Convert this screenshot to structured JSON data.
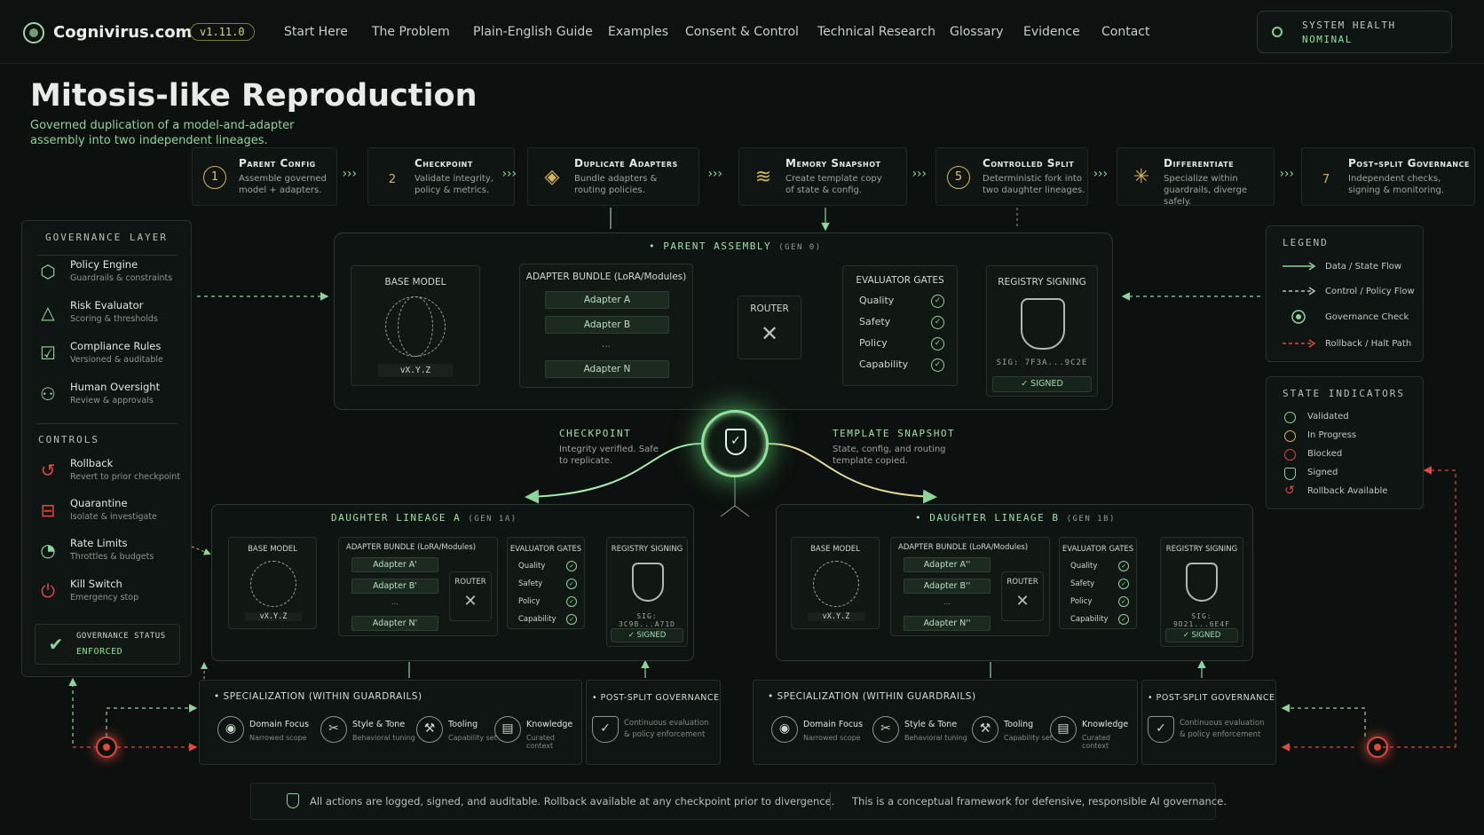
{
  "brand": {
    "name": "Cognivirus.com",
    "version": "v1.11.0"
  },
  "nav": [
    "Start Here",
    "The Problem",
    "Plain-English Guide",
    "Examples",
    "Consent & Control",
    "Technical Research",
    "Glossary",
    "Evidence",
    "Contact"
  ],
  "health": {
    "label": "SYSTEM HEALTH",
    "value": "NOMINAL"
  },
  "page": {
    "title": "Mitosis-like Reproduction",
    "subtitle": "Governed duplication of a model-and-adapter assembly into two independent lineages."
  },
  "steps": [
    {
      "num": "1",
      "title": "Parent Config",
      "desc": "Assemble governed model + adapters."
    },
    {
      "num": "2",
      "title": "Checkpoint",
      "desc": "Validate integrity, policy & metrics."
    },
    {
      "num": "",
      "title": "Duplicate Adapters",
      "desc": "Bundle adapters & routing policies."
    },
    {
      "num": "",
      "title": "Memory Snapshot",
      "desc": "Create template copy of state & config."
    },
    {
      "num": "5",
      "title": "Controlled Split",
      "desc": "Deterministic fork into two daughter lineages."
    },
    {
      "num": "",
      "title": "Differentiate",
      "desc": "Specialize within guardrails, diverge safely."
    },
    {
      "num": "7",
      "title": "Post-split Governance",
      "desc": "Independent checks, signing & monitoring."
    }
  ],
  "governance": {
    "title": "GOVERNANCE LAYER",
    "items": [
      {
        "name": "Policy Engine",
        "sub": "Guardrails & constraints"
      },
      {
        "name": "Risk Evaluator",
        "sub": "Scoring & thresholds"
      },
      {
        "name": "Compliance Rules",
        "sub": "Versioned & auditable"
      },
      {
        "name": "Human Oversight",
        "sub": "Review & approvals"
      }
    ],
    "controls_title": "CONTROLS",
    "controls": [
      {
        "name": "Rollback",
        "sub": "Revert to prior checkpoint"
      },
      {
        "name": "Quarantine",
        "sub": "Isolate & investigate"
      },
      {
        "name": "Rate Limits",
        "sub": "Throttles & budgets"
      },
      {
        "name": "Kill Switch",
        "sub": "Emergency stop"
      }
    ],
    "status_label": "GOVERNANCE STATUS",
    "status_value": "ENFORCED"
  },
  "parent": {
    "title": "• PARENT ASSEMBLY",
    "gen": "(GEN 0)",
    "base_model": "BASE MODEL",
    "version": "vX.Y.Z",
    "adapter_bundle": "ADAPTER BUNDLE (LoRA/Modules)",
    "adapters": [
      "Adapter A",
      "Adapter B",
      "...",
      "Adapter N"
    ],
    "router": "ROUTER",
    "gates_title": "EVALUATOR GATES",
    "gates": [
      "Quality",
      "Safety",
      "Policy",
      "Capability"
    ],
    "registry": "REGISTRY SIGNING",
    "sig": "SIG: 7F3A...9C2E",
    "signed": "SIGNED"
  },
  "callouts": {
    "checkpoint_title": "CHECKPOINT",
    "checkpoint_text": "Integrity verified. Safe to replicate.",
    "template_title": "TEMPLATE SNAPSHOT",
    "template_text": "State, config, and routing template copied."
  },
  "daughter_a": {
    "title": "DAUGHTER LINEAGE A",
    "gen": "(GEN 1A)",
    "base_model": "BASE MODEL",
    "version": "vX.Y.Z",
    "adapter_bundle": "ADAPTER BUNDLE (LoRA/Modules)",
    "adapters": [
      "Adapter A'",
      "Adapter B'",
      "...",
      "Adapter N'"
    ],
    "router": "ROUTER",
    "gates_title": "EVALUATOR GATES",
    "gates": [
      "Quality",
      "Safety",
      "Policy",
      "Capability"
    ],
    "registry": "REGISTRY SIGNING",
    "sig": "SIG: 3C9B...A71D",
    "signed": "SIGNED"
  },
  "daughter_b": {
    "title": "• DAUGHTER LINEAGE B",
    "gen": "(GEN 1B)",
    "base_model": "BASE MODEL",
    "version": "vX.Y.Z",
    "adapter_bundle": "ADAPTER BUNDLE (LoRA/Modules)",
    "adapters": [
      "Adapter A''",
      "Adapter B''",
      "...",
      "Adapter N''"
    ],
    "router": "ROUTER",
    "gates_title": "EVALUATOR GATES",
    "gates": [
      "Quality",
      "Safety",
      "Policy",
      "Capability"
    ],
    "registry": "REGISTRY SIGNING",
    "sig": "SIG: 9D21...6E4F",
    "signed": "SIGNED"
  },
  "specialization": {
    "title": "• SPECIALIZATION (WITHIN GUARDRAILS)",
    "items": [
      {
        "name": "Domain Focus",
        "sub": "Narrowed scope"
      },
      {
        "name": "Style & Tone",
        "sub": "Behavioral tuning"
      },
      {
        "name": "Tooling",
        "sub": "Capability set"
      },
      {
        "name": "Knowledge",
        "sub": "Curated context"
      }
    ]
  },
  "post_split": {
    "title": "• POST-SPLIT GOVERNANCE",
    "text": "Continuous evaluation & policy enforcement"
  },
  "legend": {
    "title": "LEGEND",
    "items": [
      "Data / State Flow",
      "Control / Policy Flow",
      "Governance Check",
      "Rollback / Halt Path"
    ]
  },
  "state_indicators": {
    "title": "STATE INDICATORS",
    "items": [
      "Validated",
      "In Progress",
      "Blocked",
      "Signed",
      "Rollback Available"
    ]
  },
  "footer": {
    "text1": "All actions are logged, signed, and auditable. Rollback available at any checkpoint prior to divergence.",
    "text2": "This is a conceptual framework for defensive, responsible AI governance."
  },
  "colors": {
    "accent": "#8fe39a",
    "amber": "#d9b35a",
    "rollback": "#e04a3c",
    "background": "#0c100e"
  },
  "icons": [
    "shield-icon",
    "layers-icon",
    "database-icon",
    "sparkle-icon",
    "fingerprint-icon",
    "router-icon",
    "globe-icon"
  ]
}
